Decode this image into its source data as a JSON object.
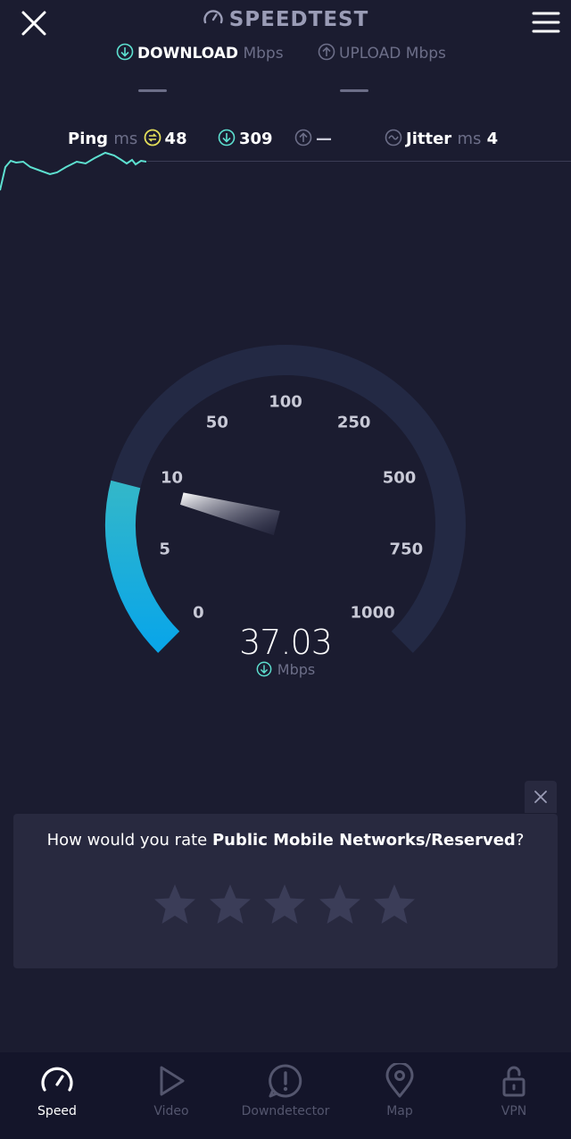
{
  "header": {
    "title": "SPEEDTEST",
    "close_icon": "close-icon",
    "menu_icon": "hamburger-menu-icon"
  },
  "measure": {
    "download_label": "DOWNLOAD",
    "download_unit": "Mbps",
    "upload_label": "UPLOAD",
    "upload_unit": "Mbps",
    "download_value": "—",
    "upload_value": "—"
  },
  "metrics": {
    "ping_label": "Ping",
    "ping_unit": "ms",
    "ping_value": "48",
    "download_latency": "309",
    "upload_latency": "—",
    "jitter_label": "Jitter",
    "jitter_unit": "ms",
    "jitter_value": "4"
  },
  "gauge": {
    "ticks": [
      "0",
      "5",
      "10",
      "50",
      "100",
      "250",
      "500",
      "750",
      "1000"
    ],
    "current_value": "37.03",
    "unit": "Mbps",
    "fill_fraction": 0.22,
    "colors": {
      "fill": "#1ea8e0",
      "track": "#252a45"
    }
  },
  "rating": {
    "question_prefix": "How would you rate ",
    "provider": "Public Mobile Networks/Reserved",
    "question_suffix": "?",
    "star_count": 5,
    "stars_selected": 0
  },
  "nav": {
    "items": [
      {
        "label": "Speed",
        "icon": "speedometer-icon",
        "active": true
      },
      {
        "label": "Video",
        "icon": "play-icon",
        "active": false
      },
      {
        "label": "Downdetector",
        "icon": "alert-icon",
        "active": false
      },
      {
        "label": "Map",
        "icon": "map-pin-icon",
        "active": false
      },
      {
        "label": "VPN",
        "icon": "unlock-icon",
        "active": false
      }
    ]
  },
  "colors": {
    "background": "#1b1c30",
    "accent_teal": "#5de0d0",
    "accent_yellow": "#e5e05a",
    "panel": "#28293f"
  }
}
